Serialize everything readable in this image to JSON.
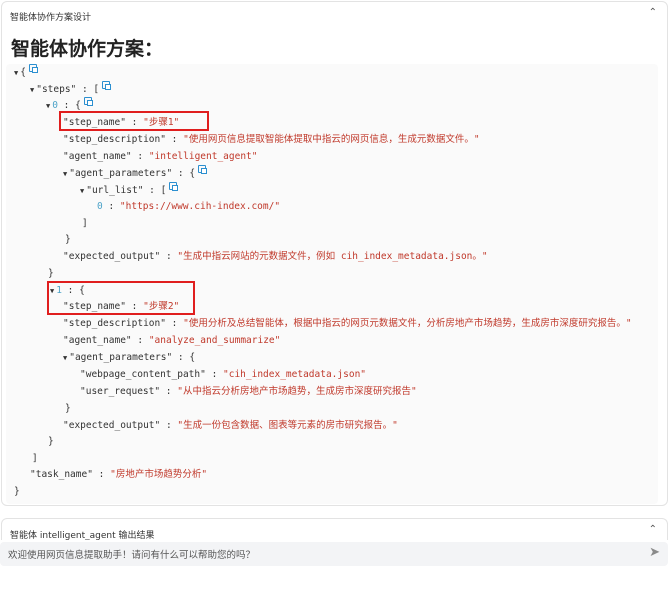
{
  "panel": {
    "title": "智能体协作方案设计",
    "heading": "智能体协作方案："
  },
  "json": {
    "open_brace": "{",
    "close_brace": "}",
    "steps_key": "\"steps\"",
    "task_name_key": "\"task_name\"",
    "task_name_value": "\"房地产市场趋势分析\"",
    "steps": [
      {
        "index": "0",
        "step_name_key": "\"step_name\"",
        "step_name_value": "\"步骤1\"",
        "step_description_key": "\"step_description\"",
        "step_description_value": "\"使用网页信息提取智能体提取中指云的网页信息，生成元数据文件。\"",
        "agent_name_key": "\"agent_name\"",
        "agent_name_value": "\"intelligent_agent\"",
        "agent_parameters_key": "\"agent_parameters\"",
        "url_list_key": "\"url_list\"",
        "url_index": "0",
        "url_value": "\"https://www.cih-index.com/\"",
        "expected_output_key": "\"expected_output\"",
        "expected_output_value": "\"生成中指云网站的元数据文件，例如 cih_index_metadata.json。\""
      },
      {
        "index": "1",
        "step_name_key": "\"step_name\"",
        "step_name_value": "\"步骤2\"",
        "step_description_key": "\"step_description\"",
        "step_description_value": "\"使用分析及总结智能体，根据中指云的网页元数据文件，分析房地产市场趋势，生成房市深度研究报告。\"",
        "agent_name_key": "\"agent_name\"",
        "agent_name_value": "\"analyze_and_summarize\"",
        "agent_parameters_key": "\"agent_parameters\"",
        "webpage_content_path_key": "\"webpage_content_path\"",
        "webpage_content_path_value": "\"cih_index_metadata.json\"",
        "user_request_key": "\"user_request\"",
        "user_request_value": "\"从中指云分析房地产市场趋势，生成房市深度研究报告\"",
        "expected_output_key": "\"expected_output\"",
        "expected_output_value": "\"生成一份包含数据、图表等元素的房市研究报告。\""
      }
    ]
  },
  "panel2": {
    "title": "智能体 intelligent_agent 输出结果"
  },
  "chat": {
    "placeholder": "欢迎使用网页信息提取助手！请问有什么可以帮助您的吗？"
  },
  "colors": {
    "string": "#c0392b",
    "index": "#4da3c8",
    "highlight": "#e01e1e",
    "copy_icon": "#2b8fd0"
  }
}
